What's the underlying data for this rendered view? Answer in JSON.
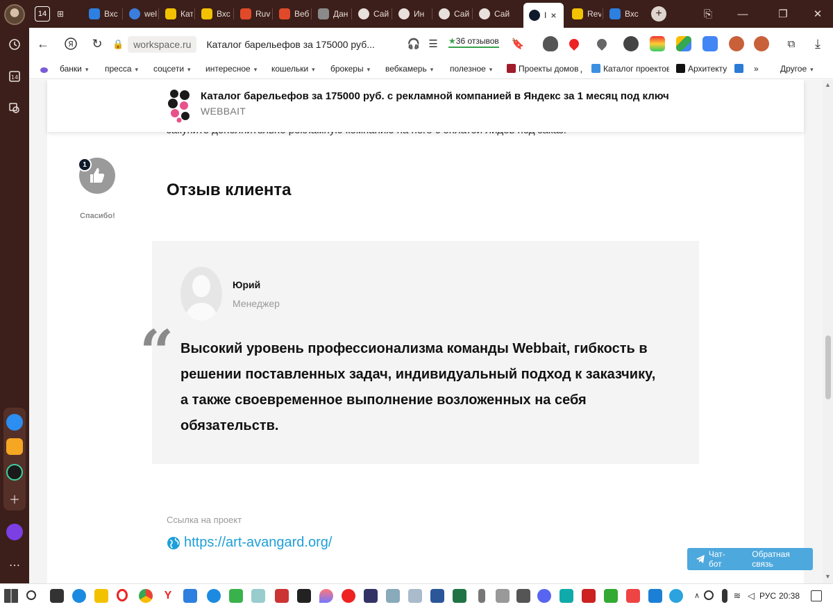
{
  "browser": {
    "tabs": [
      {
        "label": "14",
        "color": "#ffffff",
        "kind": "counter"
      },
      {
        "label": "",
        "color": "#d8cbc4",
        "kind": "new-group"
      },
      {
        "label": "Вхс",
        "color": "#2d7fe0"
      },
      {
        "label": "wel",
        "color": "#3b7ddd"
      },
      {
        "label": "Кат",
        "color": "#f2c200"
      },
      {
        "label": "Вхс",
        "color": "#f2c200"
      },
      {
        "label": "Ruv",
        "color": "#e04a2a"
      },
      {
        "label": "Веб",
        "color": "#e04a2a"
      },
      {
        "label": "Дан",
        "color": "#8a8a8a"
      },
      {
        "label": "Сай",
        "color": "#e8e0dc"
      },
      {
        "label": "Ин",
        "color": "#e8e0dc"
      },
      {
        "label": "Сай",
        "color": "#e8e0dc"
      },
      {
        "label": "Сай",
        "color": "#e8e0dc"
      },
      {
        "label": "I",
        "color": "#0f1a2a",
        "active": true
      },
      {
        "label": "Rev",
        "color": "#f2c200"
      },
      {
        "label": "Вхс",
        "color": "#2d7fe0"
      }
    ],
    "address": {
      "domain": "workspace.ru",
      "title": "Каталог барельефов за 175000 руб...",
      "reviews_badge": "36 отзывов"
    },
    "bookmarks": [
      {
        "label": "банки",
        "dropdown": true
      },
      {
        "label": "пресса",
        "dropdown": true
      },
      {
        "label": "соцсети",
        "dropdown": true
      },
      {
        "label": "интересное",
        "dropdown": true
      },
      {
        "label": "кошельки",
        "dropdown": true
      },
      {
        "label": "брокеры",
        "dropdown": true
      },
      {
        "label": "вебкамерь",
        "dropdown": true
      },
      {
        "label": "полезное",
        "dropdown": true
      },
      {
        "label": "Проекты домов д",
        "dropdown": false
      },
      {
        "label": "Каталог проектов",
        "dropdown": false
      },
      {
        "label": "Архитекту",
        "dropdown": false
      },
      {
        "label": "Другое",
        "dropdown": true
      }
    ]
  },
  "page": {
    "sticky_header": {
      "title": "Каталог барельефов за 175000 руб. с рекламной компанией в Яндекс за 1 месяц под ключ",
      "brand": "WEBBAIT"
    },
    "cut_text": "закупите дополнительно рекламную компанию на него с оплатой лидов под заказ.",
    "thanks": {
      "count": "1",
      "label": "Спасибо!"
    },
    "section_heading": "Отзыв клиента",
    "review": {
      "name": "Юрий",
      "role": "Менеджер",
      "quote_glyph": "“",
      "text": "Высокий уровень профессионализма команды Webbait, гибкость в решении поставленных задач, индивидуальный подход к заказчику, а также своевременное выполнение возложенных на себя обязательств."
    },
    "project": {
      "label": "Ссылка на проект",
      "url": "https://art-avangard.org/"
    },
    "chat_widget": {
      "bot_label": "Чат-бот",
      "feedback_label": "Обратная связь"
    }
  },
  "taskbar": {
    "language": "РУС",
    "time": "20:38"
  },
  "colors": {
    "sidebar_bg": "#3c1f1a",
    "link": "#1e9fd8",
    "review_bg": "#f4f4f4",
    "chat_bg": "#4da8dd"
  }
}
